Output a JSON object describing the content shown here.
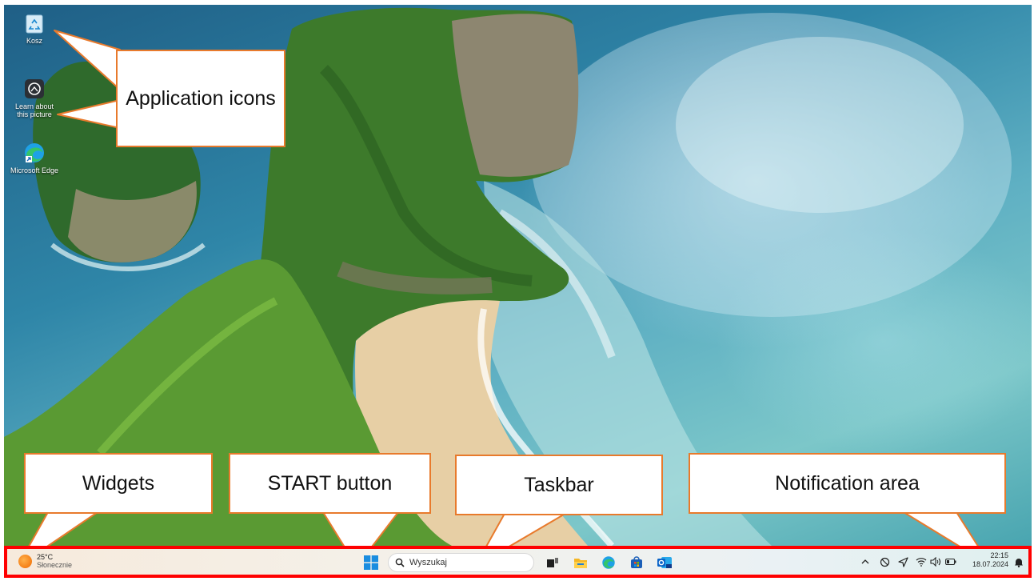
{
  "desktop_icons": [
    {
      "name": "recycle-bin",
      "label": "Kosz"
    },
    {
      "name": "learn-about-picture",
      "label": "Learn about this picture"
    },
    {
      "name": "microsoft-edge",
      "label": "Microsoft Edge"
    }
  ],
  "callouts": {
    "application_icons": "Application icons",
    "widgets": "Widgets",
    "start_button": "START button",
    "taskbar": "Taskbar",
    "notification_area": "Notification area"
  },
  "taskbar": {
    "weather": {
      "temperature": "25°C",
      "condition": "Słonecznie"
    },
    "search_placeholder": "Wyszukaj",
    "pinned_apps": [
      "task-view",
      "file-explorer",
      "microsoft-edge",
      "microsoft-store",
      "outlook"
    ],
    "tray_icons": [
      "chevron-up-icon",
      "accessibility-icon",
      "location-icon",
      "wifi-icon",
      "volume-icon",
      "battery-icon"
    ],
    "clock": {
      "time": "22:15",
      "date": "18.07.2024"
    },
    "notification_icon": "bell-icon"
  },
  "colors": {
    "callout_border": "#e87a2c",
    "taskbar_highlight": "#ff0000",
    "accent": "#0078d4"
  }
}
